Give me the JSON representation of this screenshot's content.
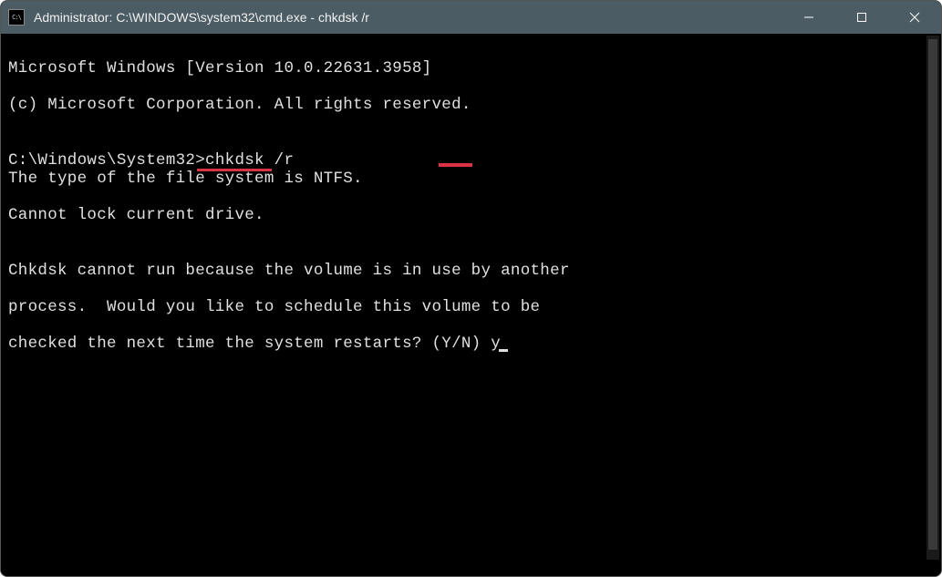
{
  "titlebar": {
    "icon_text": "C:\\",
    "title": "Administrator: C:\\WINDOWS\\system32\\cmd.exe - chkdsk  /r"
  },
  "terminal": {
    "line1": "Microsoft Windows [Version 10.0.22631.3958]",
    "line2": "(c) Microsoft Corporation. All rights reserved.",
    "blank1": "",
    "prompt_prefix": "C:\\Windows\\System32>",
    "command": "chkdsk /r",
    "line4": "The type of the file system is NTFS.",
    "line5": "Cannot lock current drive.",
    "blank2": "",
    "line6": "Chkdsk cannot run because the volume is in use by another",
    "line7": "process.  Would you like to schedule this volume to be",
    "line8_prefix": "checked the next time the system restarts? (Y/N) ",
    "response": "y"
  }
}
